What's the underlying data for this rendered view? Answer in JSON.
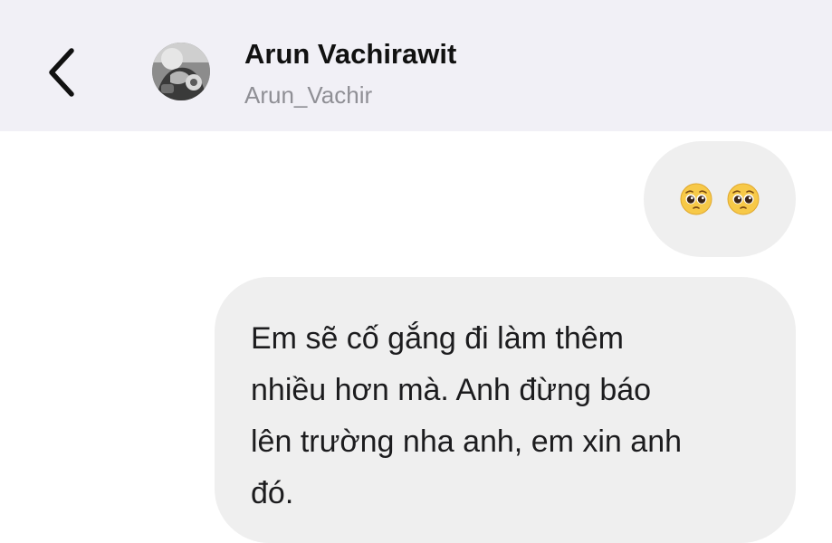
{
  "header": {
    "contact_name": "Arun Vachirawit",
    "contact_handle": "Arun_Vachir",
    "back_icon": "chevron-left-icon",
    "background": "#f1f0f6"
  },
  "messages": [
    {
      "type": "emoji",
      "direction": "outgoing",
      "emoji": [
        "🥹",
        "🥹"
      ]
    },
    {
      "type": "text",
      "direction": "outgoing",
      "text": "Em sẽ cố gắng đi làm thêm\nnhiều hơn mà. Anh đừng báo\nlên trường nha anh, em xin anh\nđó."
    }
  ],
  "colors": {
    "bubble": "#efefef",
    "name": "#111111",
    "handle": "#8f8f95"
  }
}
